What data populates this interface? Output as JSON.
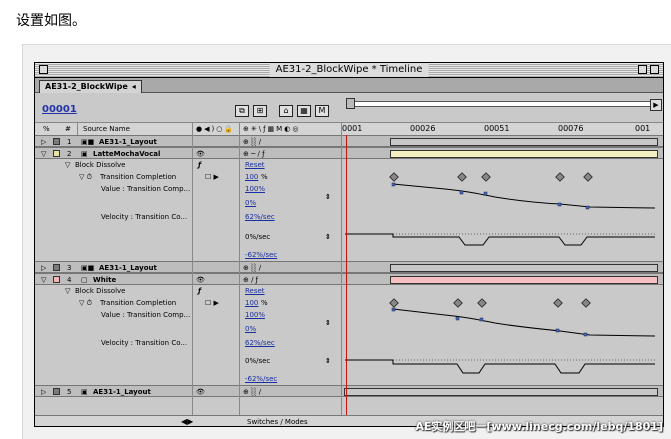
{
  "caption": "设置如图。",
  "window": {
    "title": "AE31-2_BlockWipe * Timeline",
    "tab": "AE31-2_BlockWipe",
    "timecode": "00001"
  },
  "header": {
    "source_name": "Source Name",
    "ticks": [
      "0001",
      "00026",
      "00051",
      "00076",
      "001"
    ]
  },
  "layers": [
    {
      "num": "1",
      "name": "AE31-1_Layout",
      "color": "#7a7a7a"
    },
    {
      "num": "2",
      "name": "LatteMochaVocal",
      "color": "#e8e2a0"
    },
    {
      "num": "3",
      "name": "AE31-1_Layout",
      "color": "#7a7a7a"
    },
    {
      "num": "4",
      "name": "White",
      "color": "#f2b4b4"
    },
    {
      "num": "5",
      "name": "AE31-1_Layout",
      "color": "#7a7a7a"
    }
  ],
  "effect_rows": {
    "block_dissolve": "Block Dissolve",
    "reset": "Reset",
    "transition_completion": "Transition Completion",
    "tc_value": "100",
    "tc_unit": "%",
    "value_label": "Value : Transition Comp...",
    "velocity_label": "Velocity : Transition Co...",
    "v_max": "100%",
    "v_min": "0%",
    "vel_max": "62%/sec",
    "vel_mid": "0%/sec",
    "vel_min": "-62%/sec"
  },
  "footer": {
    "switches": "Switches / Modes"
  },
  "watermark": "AE实例区吧一[www.linecg.com/lebq/1801]"
}
